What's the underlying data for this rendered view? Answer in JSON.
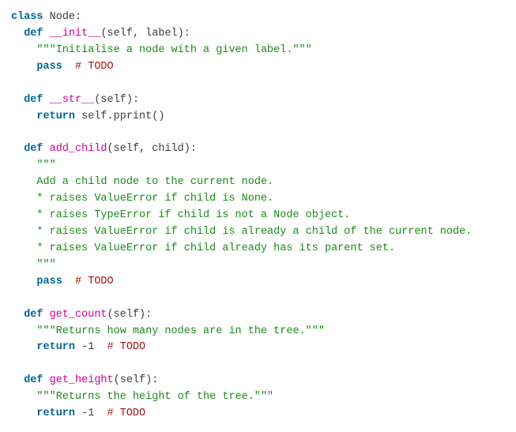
{
  "code": {
    "class_kw": "class",
    "class_name": "Node",
    "colon": ":",
    "def_kw": "def",
    "return_kw": "return",
    "pass_kw": "pass",
    "todo_comment": "# TODO",
    "methods": {
      "init": {
        "name": "__init__",
        "params": "(self, label):",
        "doc": "\"\"\"Initialise a node with a given label.\"\"\""
      },
      "str": {
        "name": "__str__",
        "params": "(self):",
        "ret_expr": "self.pprint()"
      },
      "add_child": {
        "name": "add_child",
        "params": "(self, child):",
        "doc_open": "\"\"\"",
        "doc_l1": "Add a child node to the current node.",
        "doc_l2": "* raises ValueError if child is None.",
        "doc_l3": "* raises TypeError if child is not a Node object.",
        "doc_l4": "* raises ValueError if child is already a child of the current node.",
        "doc_l5": "* raises ValueError if child already has its parent set.",
        "doc_close": "\"\"\""
      },
      "get_count": {
        "name": "get_count",
        "params": "(self):",
        "doc": "\"\"\"Returns how many nodes are in the tree.\"\"\"",
        "ret_expr": "-1"
      },
      "get_height": {
        "name": "get_height",
        "params": "(self):",
        "doc": "\"\"\"Returns the height of the tree.\"\"\"",
        "ret_expr": "-1"
      }
    }
  }
}
